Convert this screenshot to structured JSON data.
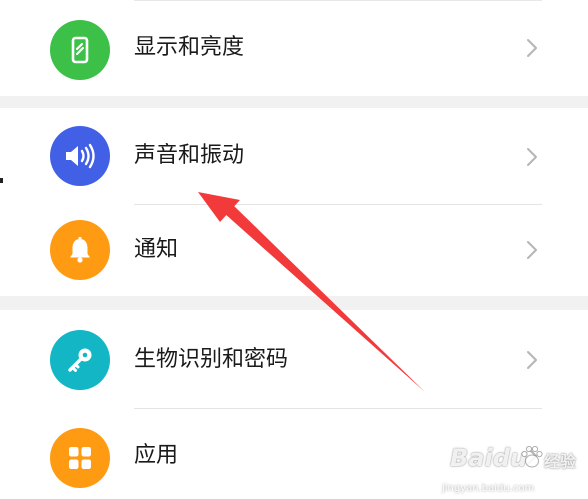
{
  "settings": {
    "items": [
      {
        "label": "显示和亮度",
        "icon": "phone-display-icon",
        "color": "#3cc048"
      },
      {
        "label": "声音和振动",
        "icon": "speaker-volume-icon",
        "color": "#4260e6"
      },
      {
        "label": "通知",
        "icon": "bell-icon",
        "color": "#ff9a13"
      },
      {
        "label": "生物识别和密码",
        "icon": "key-icon",
        "color": "#12b6c4"
      },
      {
        "label": "应用",
        "icon": "apps-grid-icon",
        "color": "#ff9a13"
      }
    ]
  },
  "annotation": {
    "arrow_color": "#f23a3a",
    "target": "声音和振动"
  },
  "watermark": {
    "brand_text": "Baidu",
    "brand_suffix": "经验",
    "url": "jingyan.baidu.com"
  }
}
